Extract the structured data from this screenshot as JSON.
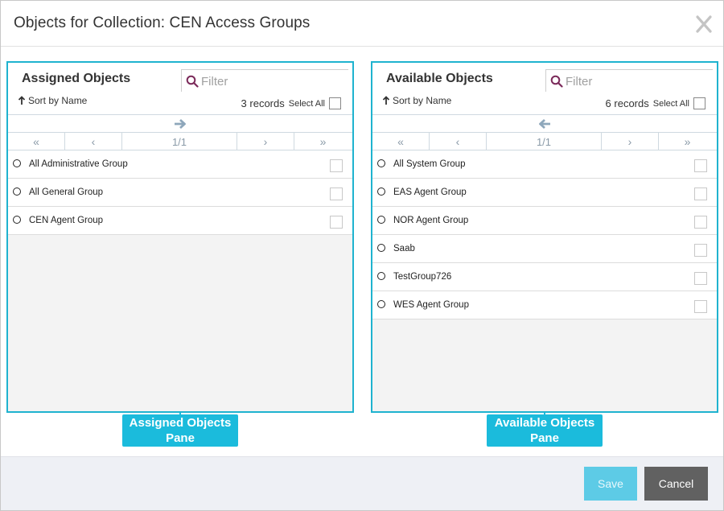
{
  "dialog": {
    "title": "Objects for Collection: CEN Access Groups",
    "close_label": "X"
  },
  "panes": {
    "assigned": {
      "title": "Assigned Objects",
      "filter_placeholder": "Filter",
      "sort_label": "Sort by Name",
      "records_label": "3 records",
      "select_all_label": "Select All",
      "move_direction": "right",
      "pager": {
        "first": "«",
        "prev": "‹",
        "position": "1/1",
        "next": "›",
        "last": "»"
      },
      "items": [
        {
          "name": "All Administrative Group"
        },
        {
          "name": "All General Group"
        },
        {
          "name": "CEN Agent Group"
        }
      ],
      "callout": [
        "Assigned Objects",
        "Pane"
      ]
    },
    "available": {
      "title": "Available Objects",
      "filter_placeholder": "Filter",
      "sort_label": "Sort by Name",
      "records_label": "6 records",
      "select_all_label": "Select All",
      "move_direction": "left",
      "pager": {
        "first": "«",
        "prev": "‹",
        "position": "1/1",
        "next": "›",
        "last": "»"
      },
      "items": [
        {
          "name": "All System Group"
        },
        {
          "name": "EAS Agent Group"
        },
        {
          "name": "NOR Agent Group"
        },
        {
          "name": "Saab"
        },
        {
          "name": "TestGroup726"
        },
        {
          "name": "WES Agent Group"
        }
      ],
      "callout": [
        "Available Objects",
        "Pane"
      ]
    }
  },
  "footer": {
    "save_label": "Save",
    "cancel_label": "Cancel"
  },
  "colors": {
    "accent": "#1fb3cf",
    "callout": "#1bbbdc",
    "save_button": "#5dcbe6",
    "cancel_button": "#616161",
    "filter_icon": "#7b2a5a",
    "pager_text": "#8a9aa8"
  },
  "icons": {
    "close": "close-icon",
    "filter": "search-icon",
    "sort": "arrow-up-icon",
    "move_right": "arrow-right-icon",
    "move_left": "arrow-left-icon"
  }
}
